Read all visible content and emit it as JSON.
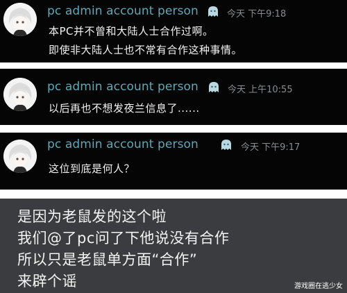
{
  "messages": [
    {
      "author": "pc admin account person",
      "badge_icon": "ghost-badge-icon",
      "timestamp": "今天 下午9:18",
      "lines": [
        "本PC并不曾和大陆人士合作过啊。",
        "即使非大陆人士也不常有合作这种事情。"
      ]
    },
    {
      "author": "pc admin account person",
      "badge_icon": "ghost-badge-icon",
      "timestamp": "今天 上午10:55",
      "lines": [
        "以后再也不想发夜兰信息了......"
      ]
    },
    {
      "author": "pc admin account person",
      "badge_icon": "ghost-badge-icon",
      "timestamp": "今天 下午9:17",
      "lines": [
        "这位到底是何人？"
      ]
    }
  ],
  "caption": {
    "lines": [
      "是因为老鼠发的这个啦",
      "我们@了pc问了下他说没有合作",
      "所以只是老鼠单方面“合作”",
      "来辟个谣"
    ]
  },
  "watermark": "游戏圈在逃少女",
  "colors": {
    "card_bg": "#050505",
    "author_name": "#5fa8b5",
    "timestamp": "#8a8d90",
    "message_text": "#f2f2f2",
    "caption_bg": "#3b3c3f",
    "caption_text": "#f4f4f4"
  }
}
